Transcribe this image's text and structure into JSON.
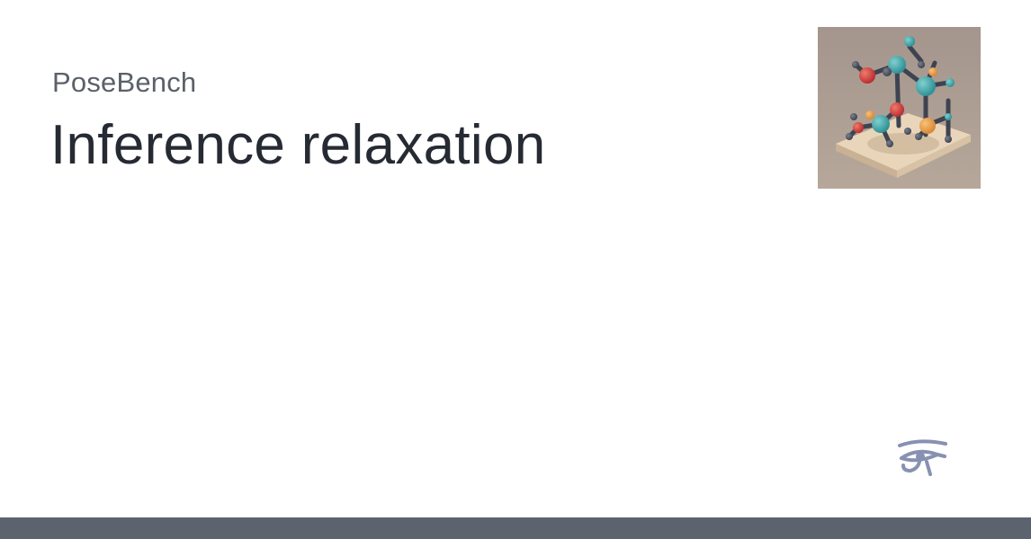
{
  "header": {
    "site_name": "PoseBench",
    "title": "Inference relaxation"
  },
  "images": {
    "logo": "molecule-illustration",
    "brand_icon": "eye-of-horus-icon"
  },
  "colors": {
    "title": "#262b33",
    "site_name": "#5b606a",
    "footer": "#5c636f",
    "brand_icon": "#8791b2"
  }
}
